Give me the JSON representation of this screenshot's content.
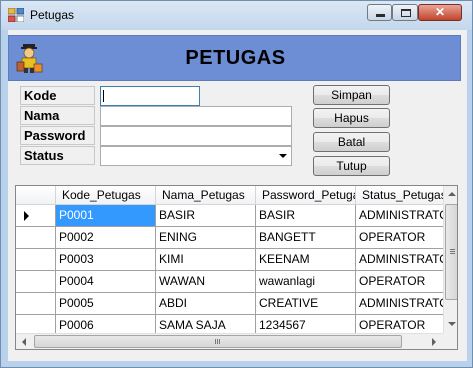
{
  "window": {
    "title": "Petugas",
    "close_glyph": "✕"
  },
  "header": {
    "title": "PETUGAS",
    "icon": "officer-icon"
  },
  "form": {
    "kode_label": "Kode",
    "nama_label": "Nama",
    "password_label": "Password",
    "status_label": "Status",
    "kode_value": "",
    "nama_value": "",
    "password_value": "",
    "status_value": ""
  },
  "buttons": {
    "simpan": "Simpan",
    "hapus": "Hapus",
    "batal": "Batal",
    "tutup": "Tutup"
  },
  "grid": {
    "columns": [
      "Kode_Petugas",
      "Nama_Petugas",
      "Password_Petugas",
      "Status_Petugas"
    ],
    "rows": [
      [
        "P0001",
        "BASIR",
        "BASIR",
        "ADMINISTRATOR"
      ],
      [
        "P0002",
        "ENING",
        "BANGETT",
        "OPERATOR"
      ],
      [
        "P0003",
        "KIMI",
        "KEENAM",
        "ADMINISTRATOR"
      ],
      [
        "P0004",
        "WAWAN",
        "wawanlagi",
        "OPERATOR"
      ],
      [
        "P0005",
        "ABDI",
        "CREATIVE",
        "ADMINISTRATOR"
      ],
      [
        "P0006",
        "SAMA SAJA",
        "1234567",
        "OPERATOR"
      ]
    ],
    "selected_row": 0,
    "selected_col": 0
  },
  "colors": {
    "header_bg": "#6d8ed4",
    "selection": "#3399ff",
    "window_frame": "#b9d1ea"
  }
}
